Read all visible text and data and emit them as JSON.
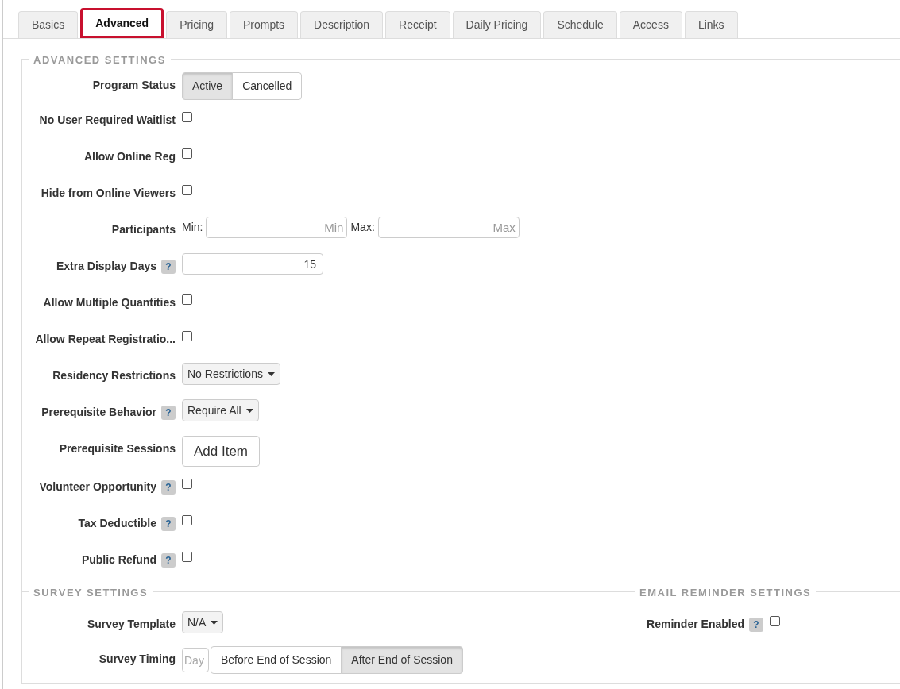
{
  "tabs": [
    {
      "label": "Basics",
      "selected": false
    },
    {
      "label": "Advanced",
      "selected": true
    },
    {
      "label": "Pricing",
      "selected": false
    },
    {
      "label": "Prompts",
      "selected": false
    },
    {
      "label": "Description",
      "selected": false
    },
    {
      "label": "Receipt",
      "selected": false
    },
    {
      "label": "Daily Pricing",
      "selected": false
    },
    {
      "label": "Schedule",
      "selected": false
    },
    {
      "label": "Access",
      "selected": false
    },
    {
      "label": "Links",
      "selected": false
    }
  ],
  "advanced_settings": {
    "title": "ADVANCED SETTINGS",
    "rows": [
      {
        "label": "Program Status",
        "kind": "segmented",
        "options": [
          {
            "label": "Active",
            "selected": true
          },
          {
            "label": "Cancelled",
            "selected": false
          }
        ]
      },
      {
        "label": "No User Required Waitlist",
        "kind": "checkbox",
        "checked": false
      },
      {
        "label": "Allow Online Reg",
        "kind": "checkbox",
        "checked": false
      },
      {
        "label": "Hide from Online Viewers",
        "kind": "checkbox",
        "checked": false
      },
      {
        "label": "Participants",
        "kind": "range",
        "min_label": "Min:",
        "min_placeholder": "Min",
        "max_label": "Max:",
        "max_placeholder": "Max"
      },
      {
        "label": "Extra Display Days",
        "help": "?",
        "kind": "number",
        "value": "15"
      },
      {
        "label": "Allow Multiple Quantities",
        "kind": "checkbox",
        "checked": false
      },
      {
        "label": "Allow Repeat Registratio...",
        "kind": "checkbox",
        "checked": false
      },
      {
        "label": "Residency Restrictions",
        "kind": "select",
        "value": "No Restrictions"
      },
      {
        "label": "Prerequisite Behavior",
        "help": "?",
        "kind": "select",
        "value": "Require All"
      },
      {
        "label": "Prerequisite Sessions",
        "kind": "button",
        "value": "Add Item"
      },
      {
        "label": "Volunteer Opportunity",
        "help": "?",
        "kind": "checkbox",
        "checked": false
      },
      {
        "label": "Tax Deductible",
        "help": "?",
        "kind": "checkbox",
        "checked": false
      },
      {
        "label": "Public Refund",
        "help": "?",
        "kind": "checkbox",
        "checked": false
      }
    ]
  },
  "survey_settings": {
    "title": "SURVEY SETTINGS",
    "rows": [
      {
        "label": "Survey Template",
        "kind": "select",
        "value": "N/A"
      },
      {
        "label": "Survey Timing",
        "kind": "timing",
        "placeholder": "Day",
        "options": [
          {
            "label": "Before End of Session",
            "selected": false
          },
          {
            "label": "After End of Session",
            "selected": true
          }
        ]
      }
    ]
  },
  "email_reminder_settings": {
    "title": "EMAIL REMINDER SETTINGS",
    "rows": [
      {
        "label": "Reminder Enabled",
        "help": "?",
        "kind": "checkbox",
        "checked": false
      }
    ]
  }
}
